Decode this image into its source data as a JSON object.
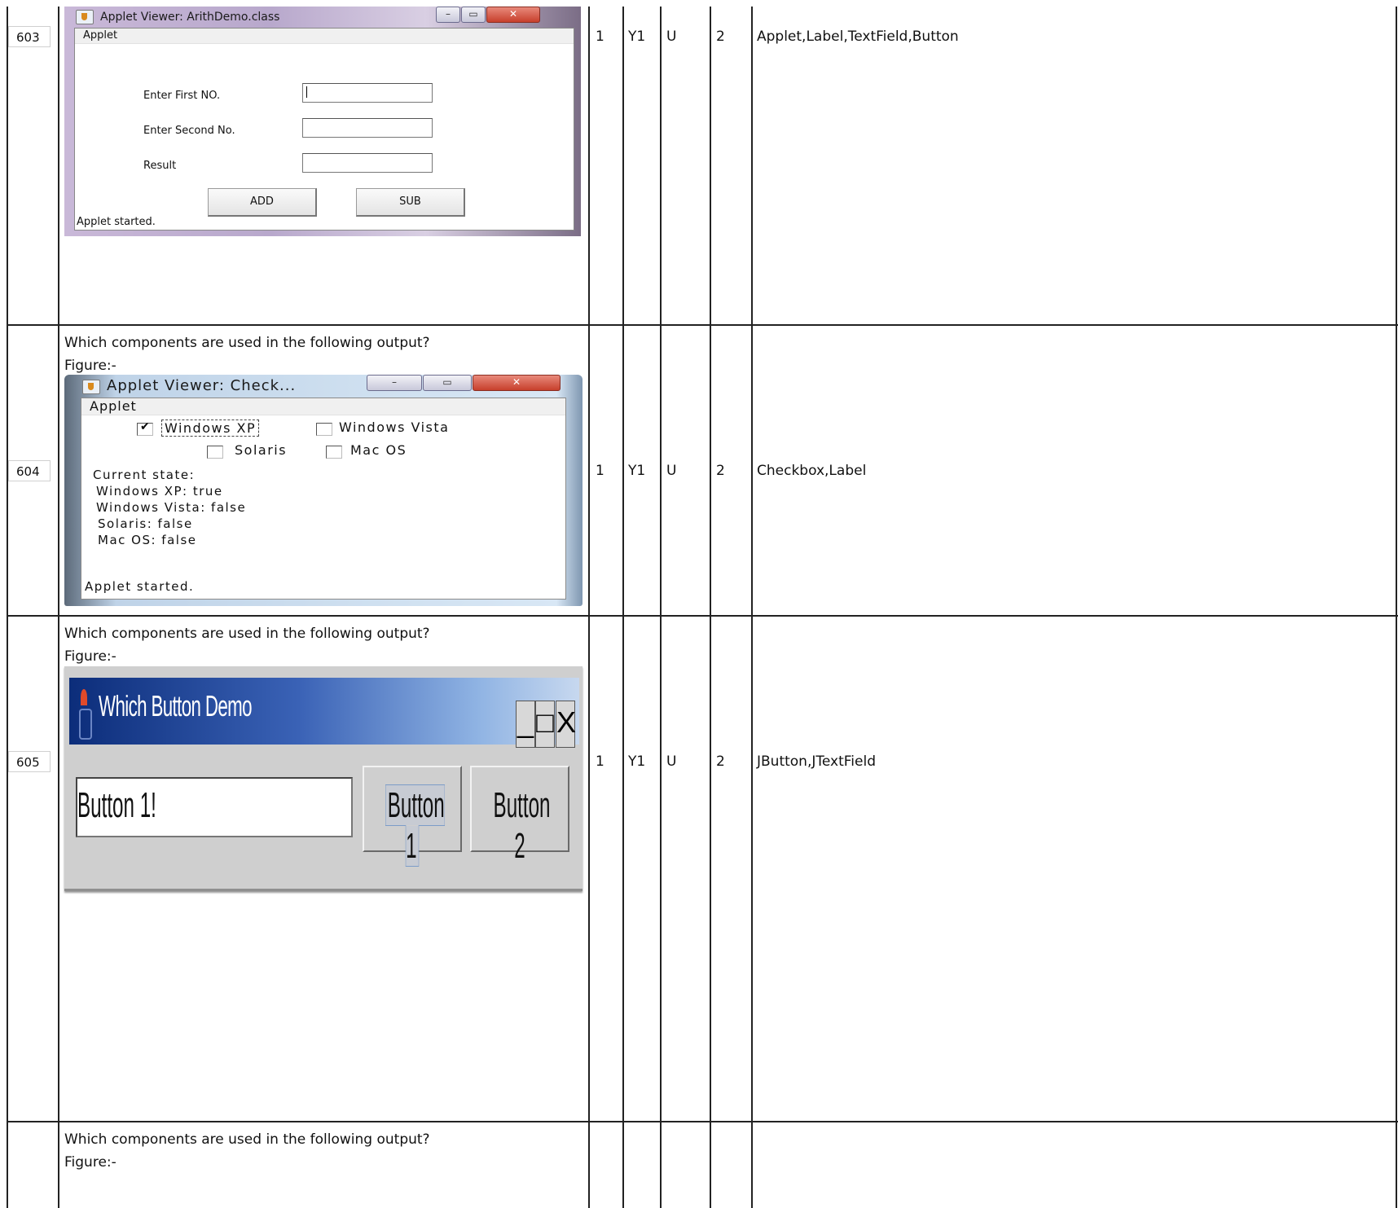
{
  "rows": [
    {
      "number": "603",
      "question": "",
      "figure_label": "",
      "marks": "1",
      "year": "Y1",
      "level": "U",
      "option": "2",
      "answer": "Applet,Label,TextField,Button",
      "window": {
        "title": "Applet Viewer: ArithDemo.class",
        "menu": "Applet",
        "labels": [
          "Enter First NO.",
          "Enter Second No.",
          "Result"
        ],
        "buttons": [
          "ADD",
          "SUB"
        ],
        "status": "Applet started."
      }
    },
    {
      "number": "604",
      "question": "Which components are used in the following output?",
      "figure_label": "Figure:-",
      "marks": "1",
      "year": "Y1",
      "level": "U",
      "option": "2",
      "answer": "Checkbox,Label",
      "window": {
        "title": "Applet Viewer: Check...",
        "menu": "Applet",
        "checkboxes": [
          {
            "label": "Windows XP",
            "checked": true
          },
          {
            "label": "Windows Vista",
            "checked": false
          },
          {
            "label": "Solaris",
            "checked": false
          },
          {
            "label": "Mac OS",
            "checked": false
          }
        ],
        "state_lines": [
          "Current state:",
          "Windows XP: true",
          "Windows Vista: false",
          "Solaris: false",
          "Mac OS: false"
        ],
        "status": "Applet started."
      }
    },
    {
      "number": "605",
      "question": "Which components are used in the following output?",
      "figure_label": "Figure:-",
      "marks": "1",
      "year": "Y1",
      "level": "U",
      "option": "2",
      "answer": "JButton,JTextField",
      "window": {
        "title": "Which Button Demo",
        "controls": [
          "_",
          "□",
          "X"
        ],
        "text_field": "Button 1!",
        "buttons": [
          "Button 1",
          "Button 2"
        ]
      }
    },
    {
      "number": "",
      "question": "Which components are used in the following output?",
      "figure_label": "Figure:-"
    }
  ]
}
